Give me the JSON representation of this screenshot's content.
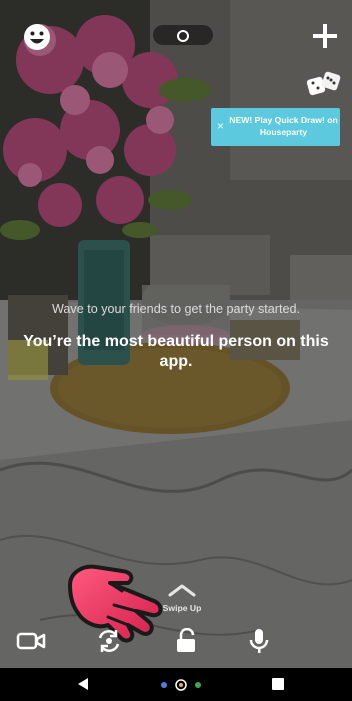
{
  "top_bar": {
    "profile_icon": "smiley-face-icon",
    "room_icon": "circle-icon",
    "add_icon": "plus-icon"
  },
  "promo": {
    "icon": "dice-icon",
    "close_icon": "close-icon",
    "close_label": "×",
    "text": "NEW! Play Quick Draw! on Houseparty",
    "color": "#5cc9de"
  },
  "center": {
    "wave_text": "Wave to your friends to get the party started.",
    "compliment": "You’re the most beautiful person on this app."
  },
  "swipe": {
    "icon": "chevron-up-icon",
    "label": "Swipe Up"
  },
  "controls": {
    "video_icon": "video-camera-icon",
    "flip_icon": "flip-camera-icon",
    "lock_icon": "unlock-icon",
    "mic_icon": "microphone-icon"
  },
  "overlay": {
    "hand_icon": "pointing-hand-icon",
    "hand_color": "#e8365f"
  },
  "nav": {
    "back_icon": "back-triangle-icon",
    "home_icon": "home-dots-icon",
    "recents_icon": "recents-square-icon"
  }
}
